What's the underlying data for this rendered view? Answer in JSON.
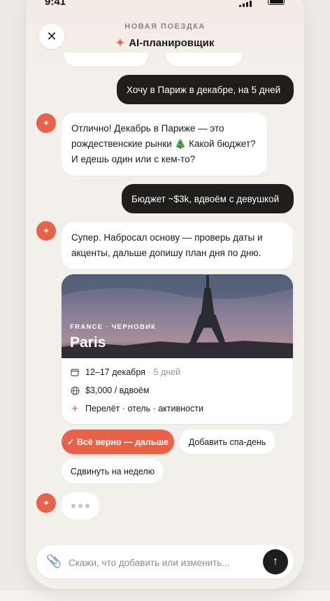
{
  "status": {
    "time": "9:41"
  },
  "header": {
    "close_icon": "close-icon",
    "subtitle": "НОВАЯ ПОЕЗДКА",
    "title": "AI-планировщик",
    "title_icon": "sparkle-icon"
  },
  "messages": {
    "user1": "Хочу в Париж в декабре, на 5 дней",
    "ai1": "Отлично! Декабрь в Париже — это рождественские рынки 🎄 Какой бюджет? И едешь один или с кем-то?",
    "user2": "Бюджет ~$3k, вдвоём с девушкой",
    "ai2": "Супер. Набросал основу — проверь даты и акценты, дальше допишу план дня по дню."
  },
  "trip_card": {
    "eyebrow": "FRANCE · ЧЕРНОВИК",
    "city": "Paris",
    "dates": "12–17 декабря",
    "duration": "· 5 дней",
    "budget": "$3,000 / вдвоём",
    "includes": "Перелёт · отель · активности",
    "icons": [
      "calendar-icon",
      "globe-icon",
      "plane-icon"
    ]
  },
  "quick_replies": {
    "confirm": "✓ Всё верно — дальше",
    "add_spa": "Добавить спа-день",
    "shift_week": "Сдвинуть на неделю"
  },
  "composer": {
    "placeholder": "Скажи, что добавить или изменить...",
    "attach_icon": "paperclip-icon",
    "send_icon": "arrow-up-icon"
  },
  "colors": {
    "accent": "#e8624a",
    "dark": "#1f1e1d",
    "background": "#f2f0ea"
  }
}
